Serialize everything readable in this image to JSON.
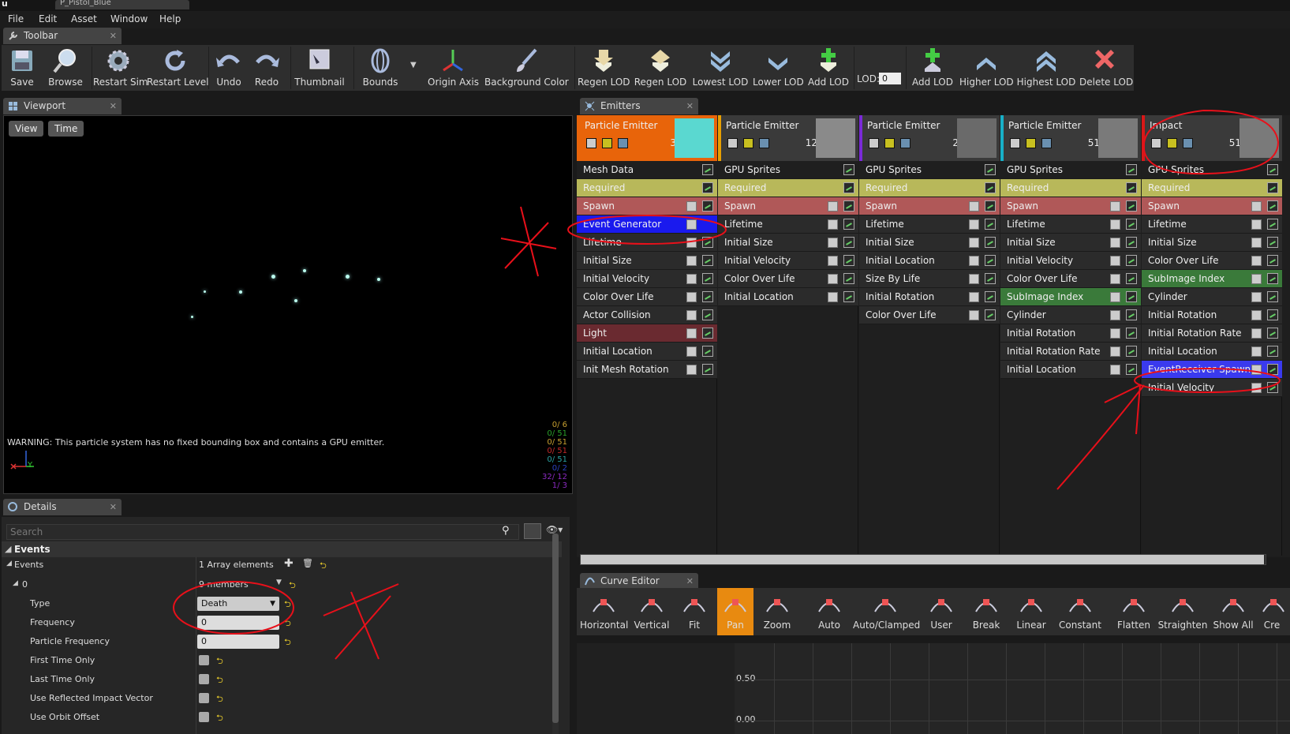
{
  "window": {
    "doc_tab": "P_Pistol_Blue"
  },
  "menu": [
    "File",
    "Edit",
    "Asset",
    "Window",
    "Help"
  ],
  "toolbar": {
    "tab": "Toolbar",
    "buttons": [
      "Save",
      "Browse",
      "Restart Sim",
      "Restart Level",
      "Undo",
      "Redo",
      "Thumbnail",
      "Bounds",
      "Origin Axis",
      "Background Color",
      "Regen LOD",
      "Regen LOD",
      "Highest LOD",
      "Lower LOD",
      "Add LOD",
      "Add LOD",
      "Higher LOD",
      "Highest LOD",
      "Delete LOD"
    ],
    "lod_label": "LOD:",
    "lod_value": "0"
  },
  "viewport": {
    "tab": "Viewport",
    "view_btn": "View",
    "time_btn": "Time",
    "warning": "WARNING: This particle system has no fixed bounding box and contains a GPU emitter.",
    "axis_y": "Y",
    "stats": [
      {
        "text": "0/ 6",
        "color": "#c8a030"
      },
      {
        "text": "0/ 51",
        "color": "#2aa02a"
      },
      {
        "text": "0/ 51",
        "color": "#c8a030"
      },
      {
        "text": "0/ 51",
        "color": "#c02a2a"
      },
      {
        "text": "0/ 51",
        "color": "#2aa0a0"
      },
      {
        "text": "0/ 2",
        "color": "#2a40c0"
      },
      {
        "text": "32/ 12",
        "color": "#8a2ac0"
      },
      {
        "text": "1/ 3",
        "color": "#8a2ac0"
      }
    ]
  },
  "details": {
    "tab": "Details",
    "search_placeholder": "Search",
    "section": "Events",
    "events_label": "Events",
    "events_value": "1 Array elements",
    "index_label": "0",
    "index_value": "9 members",
    "type_label": "Type",
    "type_value": "Death",
    "frequency_label": "Frequency",
    "frequency_value": "0",
    "particle_frequency_label": "Particle Frequency",
    "particle_frequency_value": "0",
    "first_time_label": "First Time Only",
    "last_time_label": "Last Time Only",
    "reflected_label": "Use Reflected Impact Vector",
    "orbit_label": "Use Orbit Offset"
  },
  "emitters": {
    "tab": "Emitters",
    "columns": [
      {
        "title": "Particle Emitter",
        "count": "3",
        "header_color": "#e8640a",
        "border": "#e8640a",
        "thumb": "#5ad8d0",
        "type": "Mesh Data",
        "modules": [
          {
            "label": "Required",
            "color": "#b8b85a"
          },
          {
            "label": "Spawn",
            "color": "#b05858"
          },
          {
            "label": "Event Generator",
            "color": "#1a1aee"
          },
          {
            "label": "Lifetime",
            "color": "#2b2b2b"
          },
          {
            "label": "Initial Size",
            "color": "#2b2b2b"
          },
          {
            "label": "Initial Velocity",
            "color": "#2b2b2b"
          },
          {
            "label": "Color Over Life",
            "color": "#2b2b2b"
          },
          {
            "label": "Actor Collision",
            "color": "#2b2b2b"
          },
          {
            "label": "Light",
            "color": "#6a2a30"
          },
          {
            "label": "Initial Location",
            "color": "#2b2b2b"
          },
          {
            "label": "Init Mesh Rotation",
            "color": "#2b2b2b"
          }
        ]
      },
      {
        "title": "Particle Emitter",
        "count": "12",
        "header_color": "#3a3a3a",
        "border": "#e8a000",
        "thumb": "#8a8a8a",
        "type": "GPU Sprites",
        "modules": [
          {
            "label": "Required",
            "color": "#b8b85a"
          },
          {
            "label": "Spawn",
            "color": "#b05858"
          },
          {
            "label": "Lifetime",
            "color": "#2b2b2b"
          },
          {
            "label": "Initial Size",
            "color": "#2b2b2b"
          },
          {
            "label": "Initial Velocity",
            "color": "#2b2b2b"
          },
          {
            "label": "Color Over Life",
            "color": "#2b2b2b"
          },
          {
            "label": "Initial Location",
            "color": "#2b2b2b"
          }
        ]
      },
      {
        "title": "Particle Emitter",
        "count": "2",
        "header_color": "#3a3a3a",
        "border": "#7a2ad8",
        "thumb": "#6a6a6a",
        "type": "GPU Sprites",
        "modules": [
          {
            "label": "Required",
            "color": "#b8b85a"
          },
          {
            "label": "Spawn",
            "color": "#b05858"
          },
          {
            "label": "Lifetime",
            "color": "#2b2b2b"
          },
          {
            "label": "Initial Size",
            "color": "#2b2b2b"
          },
          {
            "label": "Initial Location",
            "color": "#2b2b2b"
          },
          {
            "label": "Size By Life",
            "color": "#2b2b2b"
          },
          {
            "label": "Initial Rotation",
            "color": "#2b2b2b"
          },
          {
            "label": "Color Over Life",
            "color": "#2b2b2b"
          }
        ]
      },
      {
        "title": "Particle Emitter",
        "count": "51",
        "header_color": "#3a3a3a",
        "border": "#18b0c8",
        "thumb": "#7a7a7a",
        "type": "GPU Sprites",
        "modules": [
          {
            "label": "Required",
            "color": "#b8b85a"
          },
          {
            "label": "Spawn",
            "color": "#b05858"
          },
          {
            "label": "Lifetime",
            "color": "#2b2b2b"
          },
          {
            "label": "Initial Size",
            "color": "#2b2b2b"
          },
          {
            "label": "Initial Velocity",
            "color": "#2b2b2b"
          },
          {
            "label": "Color Over Life",
            "color": "#2b2b2b"
          },
          {
            "label": "SubImage Index",
            "color": "#3a7a3a"
          },
          {
            "label": "Cylinder",
            "color": "#2b2b2b"
          },
          {
            "label": "Initial Rotation",
            "color": "#2b2b2b"
          },
          {
            "label": "Initial Rotation Rate",
            "color": "#2b2b2b"
          },
          {
            "label": "Initial Location",
            "color": "#2b2b2b"
          }
        ]
      },
      {
        "title": "Impact",
        "count": "51",
        "header_color": "#3a3a3a",
        "border": "#d81818",
        "thumb": "#7a7a7a",
        "type": "GPU Sprites",
        "modules": [
          {
            "label": "Required",
            "color": "#b8b85a"
          },
          {
            "label": "Spawn",
            "color": "#b05858"
          },
          {
            "label": "Lifetime",
            "color": "#2b2b2b"
          },
          {
            "label": "Initial Size",
            "color": "#2b2b2b"
          },
          {
            "label": "Color Over Life",
            "color": "#2b2b2b"
          },
          {
            "label": "SubImage Index",
            "color": "#3a7a3a"
          },
          {
            "label": "Cylinder",
            "color": "#2b2b2b"
          },
          {
            "label": "Initial Rotation",
            "color": "#2b2b2b"
          },
          {
            "label": "Initial Rotation Rate",
            "color": "#2b2b2b"
          },
          {
            "label": "Initial Location",
            "color": "#2b2b2b"
          },
          {
            "label": "EventReceiver Spawn",
            "color": "#3a3aee"
          },
          {
            "label": "Initial Velocity",
            "color": "#2b2b2b"
          }
        ]
      }
    ]
  },
  "curve_editor": {
    "tab": "Curve Editor",
    "buttons": [
      "Horizontal",
      "Vertical",
      "Fit",
      "Pan",
      "Zoom",
      "Auto",
      "Auto/Clamped",
      "User",
      "Break",
      "Linear",
      "Constant",
      "Flatten",
      "Straighten",
      "Show All",
      "Cre"
    ],
    "active": "Pan",
    "y_labels": [
      "0.50",
      "0.00"
    ]
  },
  "colors": {
    "accent": "#e8640a",
    "annotation": "#e8101a"
  }
}
